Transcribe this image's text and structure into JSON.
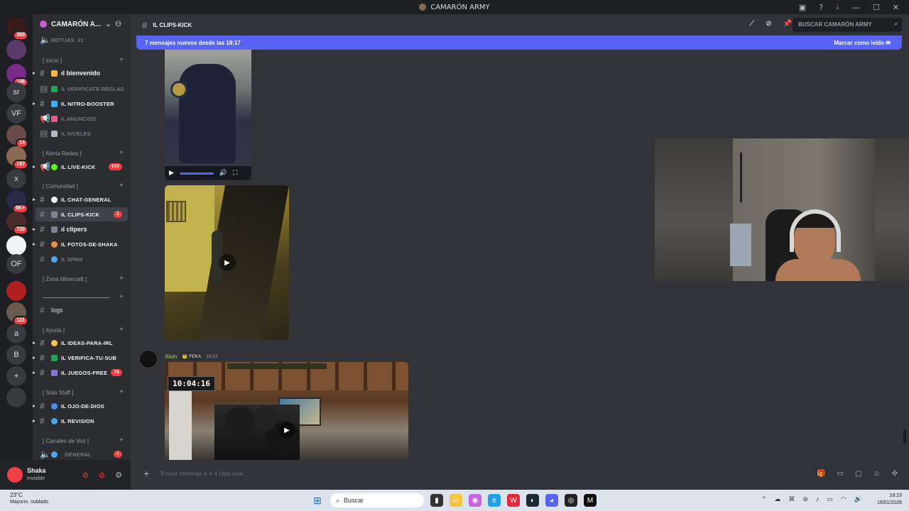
{
  "window": {
    "title": "CAMARÓN ARMY"
  },
  "servers": [
    {
      "label": "",
      "badge": "300"
    },
    {
      "label": "",
      "badge": ""
    },
    {
      "label": "",
      "badge": "106"
    },
    {
      "label": "sr",
      "badge": ""
    },
    {
      "label": "VF",
      "badge": ""
    },
    {
      "label": "",
      "badge": "14"
    },
    {
      "label": "",
      "badge": "197"
    },
    {
      "label": "x",
      "badge": ""
    },
    {
      "label": "",
      "badge": "5K+"
    },
    {
      "label": "",
      "badge": "720"
    },
    {
      "label": "",
      "badge": ""
    },
    {
      "label": "OF",
      "badge": ""
    },
    {
      "label": "",
      "badge": ""
    },
    {
      "label": "",
      "badge": "121"
    },
    {
      "label": "a",
      "badge": ""
    },
    {
      "label": "B",
      "badge": ""
    },
    {
      "label": "+",
      "badge": ""
    },
    {
      "label": "",
      "badge": ""
    }
  ],
  "sidebar": {
    "server_name": "CAMARÓN A...",
    "voice_top": "BOTIJAS: 31",
    "categories": {
      "inicio": "[ inicio ]",
      "alerta": "[ Alerta Redes ]",
      "comunidad": "[ Comunidad ]",
      "minecraft": "[ Zona Minecraft ]",
      "ayuda": "[ Ayuda ]",
      "staff": "[ Solo Staff ]",
      "voz": "[ Canales de Voz ]"
    },
    "channels": {
      "bienvenido": "ıl bienvenido",
      "verificate": "ıl verificate-reglas",
      "nitro": "ıl nitro-booster",
      "anuncios": "ıl anuncios",
      "niveles": "ıl niveles",
      "livekick": "ıl live-kick",
      "livekick_badge": "115",
      "chatgeneral": "ıl chat-general",
      "clipskick": "ıl clips-kick",
      "clipskick_badge": "1",
      "clipers": "ıl clipers",
      "fotos": "ıl fotos-de-shaka",
      "spam": "ıl spam",
      "logs": "logs",
      "ideas": "ıl ideas-para-irl",
      "verifica": "ıl verifica-tu-sub",
      "juegos": "ıl juegos-free",
      "juegos_badge": "78",
      "ojo": "ıl ojo-de-dios",
      "revision": "ıl revision",
      "general": "· general",
      "general_badge": "1"
    }
  },
  "user": {
    "name": "Shaka",
    "status": "Invisible"
  },
  "channel_header": {
    "name": "ıl clips-kick",
    "search_placeholder": "Buscar CAMARÓN ARMY"
  },
  "new_messages": {
    "text": "7 mensajes nuevos desde las 18:17",
    "action": "Marcar como leído"
  },
  "message": {
    "author": "Alvin",
    "tag": "FEKA",
    "time": "18:23"
  },
  "video3": {
    "timer": "10:04:16"
  },
  "composer": {
    "placeholder": "Enviar mensaje a # ıl clips-kick"
  },
  "taskbar": {
    "weather_temp": "23°C",
    "weather_desc": "Mayorm. nublado",
    "search": "Buscar",
    "time": "18:23",
    "date": "16/01/2026"
  },
  "colors": {
    "accent": "#5865f2",
    "danger": "#f23f43",
    "author": "#9ccc65"
  }
}
